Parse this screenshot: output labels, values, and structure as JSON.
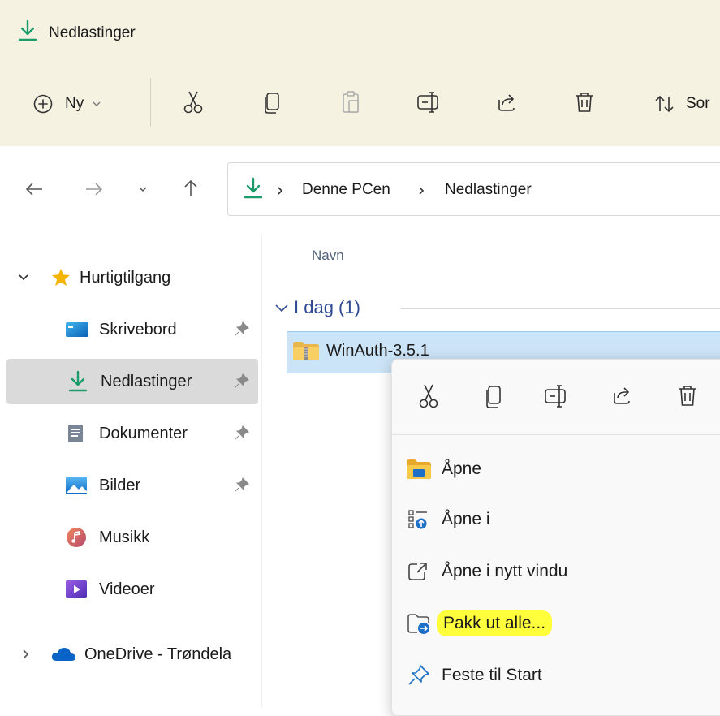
{
  "window": {
    "title": "Nedlastinger"
  },
  "toolbar": {
    "new_label": "Ny",
    "sort_label": "Sor",
    "buttons": [
      "cut-icon",
      "copy-icon",
      "paste-icon",
      "rename-icon",
      "share-icon",
      "delete-icon"
    ]
  },
  "address": {
    "crumbs": [
      "Denne PCen",
      "Nedlastinger"
    ]
  },
  "sidebar": {
    "quick_access": "Hurtigtilgang",
    "items": [
      {
        "label": "Skrivebord",
        "icon": "desktop-icon",
        "pinned": true
      },
      {
        "label": "Nedlastinger",
        "icon": "download-icon",
        "pinned": true,
        "selected": true
      },
      {
        "label": "Dokumenter",
        "icon": "document-icon",
        "pinned": true
      },
      {
        "label": "Bilder",
        "icon": "pictures-icon",
        "pinned": true
      },
      {
        "label": "Musikk",
        "icon": "music-icon",
        "pinned": false
      },
      {
        "label": "Videoer",
        "icon": "video-icon",
        "pinned": false
      }
    ],
    "onedrive": "OneDrive - Trøndela"
  },
  "content": {
    "column_name": "Navn",
    "group": "I dag (1)",
    "file": {
      "name": "WinAuth-3.5.1",
      "icon": "zip-folder-icon"
    }
  },
  "context_menu": {
    "quick_actions": [
      "cut-icon",
      "copy-icon",
      "rename-icon",
      "share-icon",
      "delete-icon"
    ],
    "items": [
      {
        "label": "Åpne",
        "icon": "folder-open-icon"
      },
      {
        "label": "Åpne i",
        "icon": "open-with-icon"
      },
      {
        "label": "Åpne i nytt vindu",
        "icon": "new-window-icon"
      },
      {
        "label": "Pakk ut alle...",
        "icon": "extract-icon",
        "highlighted": true
      },
      {
        "label": "Feste til Start",
        "icon": "pin-icon"
      }
    ]
  },
  "colors": {
    "accent": "#1c9c6a",
    "title_bg": "#f5f2e2",
    "selection": "#cce4f7",
    "highlight": "#ffff3c",
    "group_text": "#2f4a92"
  }
}
